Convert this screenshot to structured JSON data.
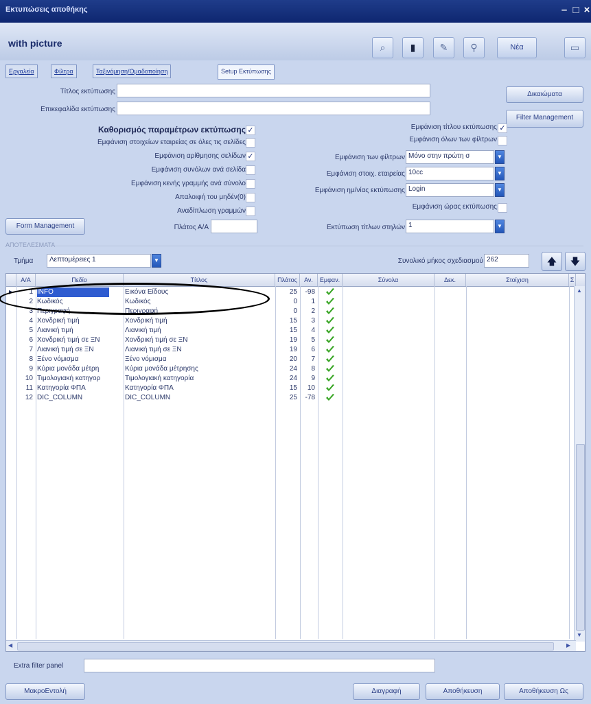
{
  "window": {
    "title": "Εκτυπώσεις αποθήκης"
  },
  "header": {
    "form_title": "with picture",
    "tools": [
      {
        "icon": "search-icon"
      },
      {
        "icon": "bookmark-icon"
      },
      {
        "icon": "edit-icon"
      },
      {
        "icon": "pin-icon"
      }
    ],
    "new_label": "Νέα",
    "close_icon": "window-icon"
  },
  "tabs": [
    "Εργαλεία",
    "Φίλτρα",
    "Ταξινόμηση/Ομαδοποίηση",
    "Setup Εκτύπωσης"
  ],
  "setup": {
    "print_title_label": "Τίτλος εκτύπωσης",
    "print_title_value": "",
    "print_subtitle_label": "Επικεφαλίδα εκτύπωσης",
    "print_subtitle_value": "",
    "definitions_button": "Δικαιώματα",
    "filter_mgmt_button": "Filter Management",
    "params_label": "Καθορισμός παραμέτρων εκτύπωσης",
    "params_checked": true,
    "left_options": [
      {
        "label": "Εμφάνιση στοιχείων εταιρείας σε όλες τις σελίδες",
        "checked": false
      },
      {
        "label": "Εμφάνιση αρίθμησης σελίδων",
        "checked": true
      },
      {
        "label": "Εμφάνιση συνόλων ανά σελίδα",
        "checked": false
      },
      {
        "label": "Εμφάνιση κενής γραμμής ανά σύνολο",
        "checked": false
      },
      {
        "label": "Απαλοιφή του μηδέν(0)",
        "checked": false
      },
      {
        "label": "Αναδίπλωση γραμμών",
        "checked": false
      }
    ],
    "right_options": [
      {
        "label": "Εμφάνιση τίτλου εκτύπωσης",
        "checked": true
      },
      {
        "label": "Εμφάνιση όλων των φίλτρων",
        "checked": false
      }
    ],
    "filters_display_label": "Εμφάνιση των φίλτρων",
    "filters_display_value": "Μόνο στην πρώτη σ",
    "company_font_label": "Εμφάνιση στοιχ. εταιρείας",
    "company_font_value": "10cc",
    "print_date_label": "Εμφάνιση ημ/νίας εκτύπωσης",
    "print_date_value": "Login",
    "print_area_label": "Εμφάνιση ώρας εκτύπωσης",
    "print_area_checked": false,
    "form_mgmt_button": "Form Management",
    "width_label": "Πλάτος Α/Α",
    "width_value": "",
    "col_titles_label": "Εκτύπωση τίτλων στηλών",
    "col_titles_value": "1"
  },
  "section_label": "ΑΠΟΤΕΛΕΣΜΑΤΑ",
  "section": {
    "label": "Τμήμα",
    "value": "Λεπτομέρειες 1",
    "total_label": "Συνολικό μήκος σχεδιασμού",
    "total_value": "262"
  },
  "grid": {
    "columns": [
      "Α/Α",
      "Πεδίο",
      "Τίτλος",
      "Πλάτος",
      "Αν.",
      "Εμφαν.",
      "Σύνολα",
      "Δεκ.",
      "Στοίχιση",
      "Σ"
    ],
    "rows": [
      {
        "n": "1",
        "field": "INFO",
        "title": "Εικόνα Είδους",
        "width": "25",
        "pos": "-98",
        "show": true
      },
      {
        "n": "2",
        "field": "Κωδικός",
        "title": "Κωδικός",
        "width": "0",
        "pos": "1",
        "show": true
      },
      {
        "n": "3",
        "field": "Περιγραφή",
        "title": "Περιγραφή",
        "width": "0",
        "pos": "2",
        "show": true
      },
      {
        "n": "4",
        "field": "Χονδρική τιμή",
        "title": "Χονδρική τιμή",
        "width": "15",
        "pos": "3",
        "show": true
      },
      {
        "n": "5",
        "field": "Λιανική τιμή",
        "title": "Λιανική τιμή",
        "width": "15",
        "pos": "4",
        "show": true
      },
      {
        "n": "6",
        "field": "Χονδρική τιμή σε ΞΝ",
        "title": "Χονδρική τιμή σε ΞΝ",
        "width": "19",
        "pos": "5",
        "show": true
      },
      {
        "n": "7",
        "field": "Λιανική τιμή σε ΞΝ",
        "title": "Λιανική τιμή σε ΞΝ",
        "width": "19",
        "pos": "6",
        "show": true
      },
      {
        "n": "8",
        "field": "Ξένο νόμισμα",
        "title": "Ξένο νόμισμα",
        "width": "20",
        "pos": "7",
        "show": true
      },
      {
        "n": "9",
        "field": "Κύρια μονάδα μέτρη",
        "title": "Κύρια μονάδα μέτρησης",
        "width": "24",
        "pos": "8",
        "show": true
      },
      {
        "n": "10",
        "field": "Τιμολογιακή κατηγορ",
        "title": "Τιμολογιακή κατηγορία",
        "width": "24",
        "pos": "9",
        "show": true
      },
      {
        "n": "11",
        "field": "Κατηγορία ΦΠΑ",
        "title": "Κατηγορία ΦΠΑ",
        "width": "15",
        "pos": "10",
        "show": true
      },
      {
        "n": "12",
        "field": "DIC_COLUMN",
        "title": "DIC_COLUMN",
        "width": "25",
        "pos": "-78",
        "show": true
      }
    ]
  },
  "extra_filter": {
    "label": "Extra filter panel",
    "value": ""
  },
  "footer": {
    "macro_button": "ΜακροΕντολή",
    "delete_button": "Διαγραφή",
    "save_button": "Αποθήκευση",
    "save_as_button": "Αποθήκευση Ως"
  }
}
